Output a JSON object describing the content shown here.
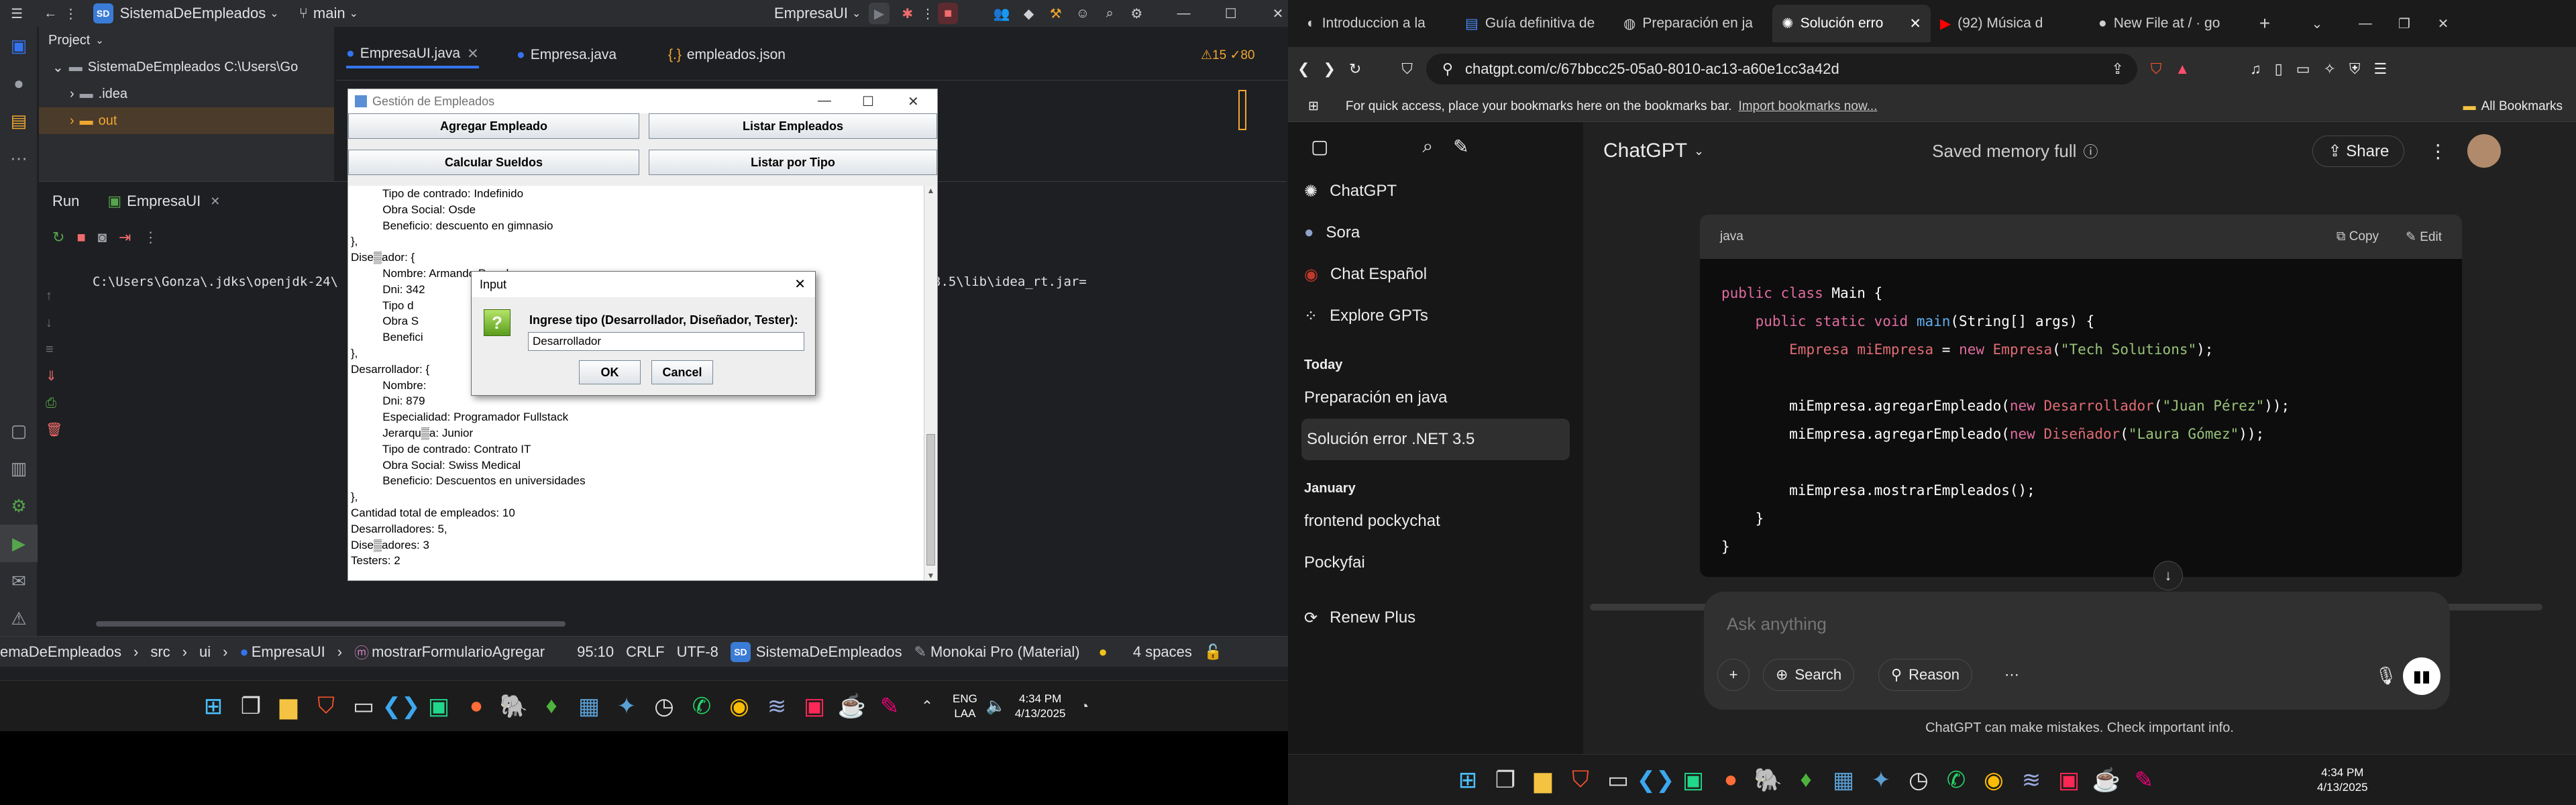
{
  "ide": {
    "project_name": "SistemaDeEmpleados",
    "branch": "main",
    "run_config": "EmpresaUI",
    "tabs": [
      {
        "label": "EmpresaUI.java"
      },
      {
        "label": "Empresa.java"
      },
      {
        "label": "empleados.json"
      }
    ],
    "project_panel": {
      "title": "Project",
      "rows": [
        "SistemaDeEmpleados  C:\\Users\\Go",
        ".idea",
        "out"
      ]
    },
    "inspections": "⚠15  ✓80",
    "run_panel": {
      "label": "Run",
      "tab": "EmpresaUI",
      "command_left": "C:\\Users\\Gonza\\.jdks\\openjdk-24\\",
      "command_right": "ty Edition 2024.3.5\\lib\\idea_rt.jar="
    },
    "status": {
      "crumbs": [
        "emaDeEmpleados",
        "src",
        "ui",
        "EmpresaUI",
        "mostrarFormularioAgregar"
      ],
      "position": "95:10",
      "line_sep": "CRLF",
      "encoding": "UTF-8",
      "project_badge": "SD",
      "project": "SistemaDeEmpleados",
      "theme": "Monokai Pro (Material)",
      "indent": "4 spaces"
    }
  },
  "swing": {
    "title": "Gestión de Empleados",
    "buttons": [
      "Agregar Empleado",
      "Listar Empleados",
      "Calcular Sueldos",
      "Listar por Tipo"
    ],
    "lines": [
      "          Tipo de contrado: Indefinido",
      "          Obra Social: Osde",
      "          Beneficio: descuento en gimnasio",
      "},",
      "Dise▒ador: {",
      "          Nombre: Armando Paredes",
      "          Dni: 342",
      "          Tipo d",
      "          Obra S",
      "          Benefici",
      "},",
      "Desarrollador: {",
      "          Nombre:",
      "          Dni: 879",
      "          Especialidad: Programador Fullstack",
      "          Jerarqu▒a: Junior",
      "          Tipo de contrado: Contrato IT",
      "          Obra Social: Swiss Medical",
      "          Beneficio: Descuentos en universidades",
      "},",
      "Cantidad total de empleados: 10",
      "Desarrolladores: 5,",
      "Dise▒adores: 3",
      "Testers: 2"
    ]
  },
  "dialog": {
    "title": "Input",
    "prompt": "Ingrese tipo (Desarrollador, Diseñador, Tester):",
    "value": "Desarrollador",
    "ok": "OK",
    "cancel": "Cancel"
  },
  "taskbar_left": {
    "lang": "ENG",
    "lang2": "LAA",
    "time": "4:34 PM",
    "date": "4/13/2025"
  },
  "taskbar_right": {
    "time": "4:34 PM",
    "date": "4/13/2025"
  },
  "browser": {
    "tabs": [
      "Introduccion a la",
      "Guía definitiva de",
      "Preparación en ja",
      "Solución erro",
      "(92) Música d",
      "New File at / · go"
    ],
    "url": "chatgpt.com/c/67bbcc25-05a0-8010-ac13-a60e1cc3a42d",
    "bookmarks_hint": "For quick access, place your bookmarks here on the bookmarks bar.",
    "bookmarks_link": "Import bookmarks now...",
    "all_bookmarks": "All Bookmarks"
  },
  "chatgpt": {
    "title": "ChatGPT",
    "memory": "Saved memory full",
    "share": "Share",
    "nav": [
      "ChatGPT",
      "Sora",
      "Chat Español",
      "Explore GPTs"
    ],
    "today_label": "Today",
    "today": [
      "Preparación en java",
      "Solución error .NET 3.5"
    ],
    "january_label": "January",
    "january": [
      "frontend pockychat",
      "Pockyfai"
    ],
    "renew": "Renew Plus",
    "code_lang": "java",
    "copy": "Copy",
    "edit": "Edit",
    "placeholder": "Ask anything",
    "search": "Search",
    "reason": "Reason",
    "disclaimer": "ChatGPT can make mistakes. Check important info."
  }
}
